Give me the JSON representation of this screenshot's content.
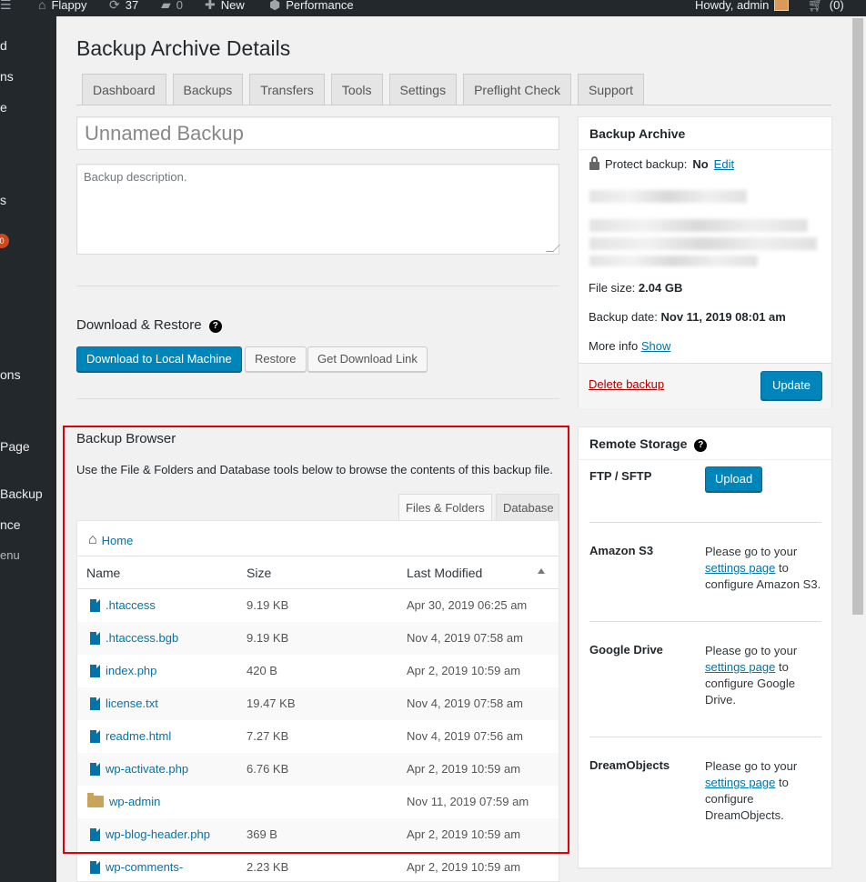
{
  "admin_bar": {
    "site_name": "Flappy",
    "updates_count": "37",
    "comments_count": "0",
    "new_label": "New",
    "performance_label": "Performance",
    "greeting": "Howdy, admin",
    "cart_count": "(0)"
  },
  "side_menu": {
    "items": [
      "d",
      "ns",
      "e",
      "s",
      "ons",
      "Page",
      "Backup",
      "nce",
      "enu"
    ],
    "badge": "0"
  },
  "page_title": "Backup Archive Details",
  "tabs": [
    "Dashboard",
    "Backups",
    "Transfers",
    "Tools",
    "Settings",
    "Preflight Check",
    "Support"
  ],
  "backup_name": {
    "placeholder": "Unnamed Backup"
  },
  "backup_description": {
    "placeholder": "Backup description."
  },
  "download_restore": {
    "title": "Download & Restore",
    "help": "?",
    "buttons": [
      "Download to Local Machine",
      "Restore",
      "Get Download Link"
    ]
  },
  "backup_browser": {
    "title": "Backup Browser",
    "description": "Use the File & Folders and Database tools below to browse the contents of this backup file.",
    "tabs": [
      "Files & Folders",
      "Database"
    ],
    "breadcrumb": "Home",
    "columns": [
      "Name",
      "Size",
      "Last Modified"
    ],
    "rows": [
      {
        "name": ".htaccess",
        "size": "9.19 KB",
        "modified": "Apr 30, 2019 06:25 am",
        "type": "file"
      },
      {
        "name": ".htaccess.bgb",
        "size": "9.19 KB",
        "modified": "Nov 4, 2019 07:58 am",
        "type": "file"
      },
      {
        "name": "index.php",
        "size": "420 B",
        "modified": "Apr 2, 2019 10:59 am",
        "type": "file"
      },
      {
        "name": "license.txt",
        "size": "19.47 KB",
        "modified": "Nov 4, 2019 07:58 am",
        "type": "file"
      },
      {
        "name": "readme.html",
        "size": "7.27 KB",
        "modified": "Nov 4, 2019 07:56 am",
        "type": "file"
      },
      {
        "name": "wp-activate.php",
        "size": "6.76 KB",
        "modified": "Apr 2, 2019 10:59 am",
        "type": "file"
      },
      {
        "name": "wp-admin",
        "size": "",
        "modified": "Nov 11, 2019 07:59 am",
        "type": "folder"
      },
      {
        "name": "wp-blog-header.php",
        "size": "369 B",
        "modified": "Apr 2, 2019 10:59 am",
        "type": "file"
      },
      {
        "name": "wp-comments-",
        "size": "2.23 KB",
        "modified": "Apr 2, 2019 10:59 am",
        "type": "file"
      }
    ]
  },
  "archive_box": {
    "title": "Backup Archive",
    "protect_label": "Protect backup:",
    "protect_value": "No",
    "edit_link": "Edit",
    "file_size_label": "File size:",
    "file_size": "2.04 GB",
    "backup_date_label": "Backup date:",
    "backup_date": "Nov 11, 2019 08:01 am",
    "more_info_label": "More info",
    "show_link": "Show",
    "delete_link": "Delete backup",
    "update_button": "Update"
  },
  "remote_storage": {
    "title": "Remote Storage",
    "help": "?",
    "ftp_label": "FTP / SFTP",
    "upload_button": "Upload",
    "providers": [
      {
        "name": "Amazon S3",
        "pre": "Please go to your",
        "link": "settings page",
        "post": "to configure Amazon S3."
      },
      {
        "name": "Google Drive",
        "pre": "Please go to your",
        "link": "settings page",
        "post": "to configure Google Drive."
      },
      {
        "name": "DreamObjects",
        "pre": "Please go to your",
        "link": "settings page",
        "post": "to configure DreamObjects."
      }
    ]
  },
  "colors": {
    "accent": "#0085ba",
    "link": "#0073aa",
    "highlight": "#e0000a",
    "delete": "#a00"
  }
}
